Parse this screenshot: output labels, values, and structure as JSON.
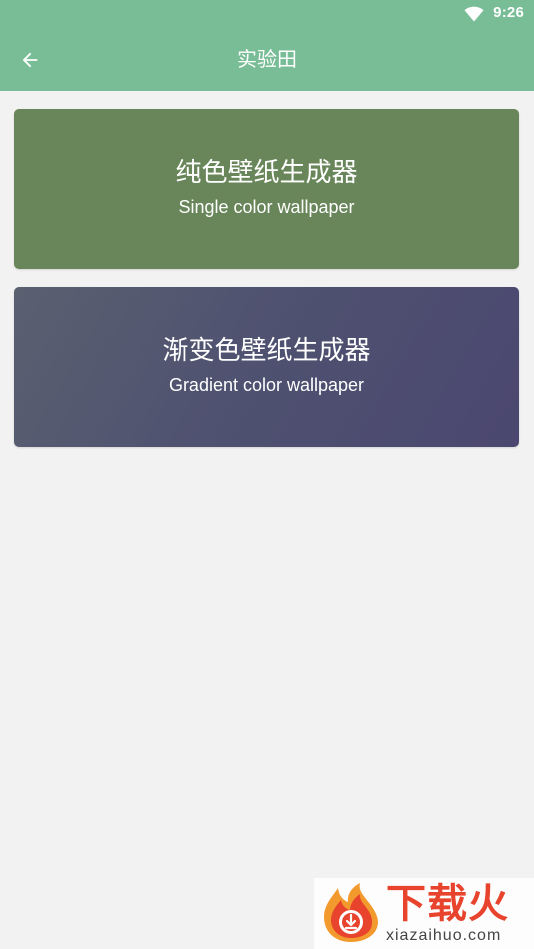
{
  "status_bar": {
    "time": "9:26",
    "icons": [
      "wifi-icon"
    ]
  },
  "app_bar": {
    "title": "实验田",
    "back_icon": "arrow-left-icon",
    "color": "#79bd97"
  },
  "cards": [
    {
      "title": "纯色壁纸生成器",
      "subtitle": "Single color wallpaper",
      "color": "#688659"
    },
    {
      "title": "渐变色壁纸生成器",
      "subtitle": "Gradient color wallpaper",
      "colors": [
        "#5a6070",
        "#4b4770"
      ]
    }
  ],
  "watermark": {
    "name": "下载火",
    "domain": "xiazaihuo.com",
    "icon": "flame-download-logo"
  }
}
